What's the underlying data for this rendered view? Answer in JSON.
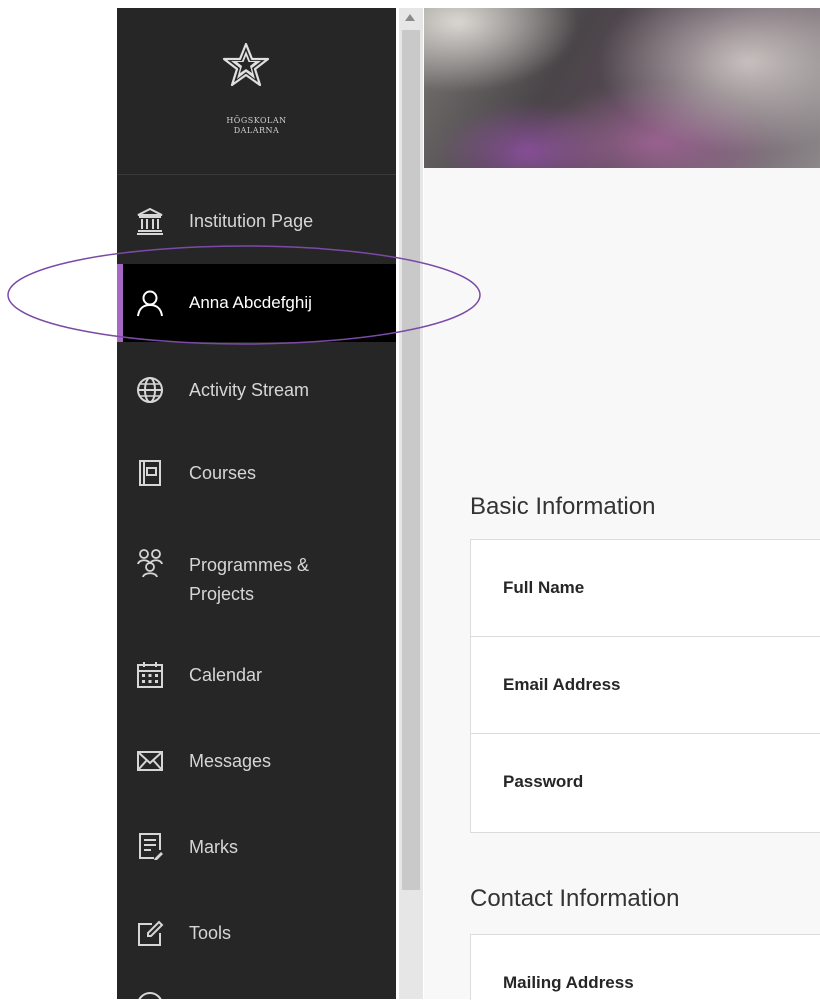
{
  "app": {
    "logo_text_line1": "HÖGSKOLAN",
    "logo_text_line2": "DALARNA"
  },
  "sidebar": {
    "items": [
      {
        "id": "institution",
        "label": "Institution Page",
        "icon": "institution-icon"
      },
      {
        "id": "profile",
        "label": "Anna Abcdefghij",
        "icon": "user-icon",
        "active": true
      },
      {
        "id": "activity",
        "label": "Activity Stream",
        "icon": "globe-icon"
      },
      {
        "id": "courses",
        "label": "Courses",
        "icon": "courses-icon"
      },
      {
        "id": "programmes",
        "label_line1": "Programmes &",
        "label_line2": "Projects",
        "icon": "people-icon"
      },
      {
        "id": "calendar",
        "label": "Calendar",
        "icon": "calendar-icon"
      },
      {
        "id": "messages",
        "label": "Messages",
        "icon": "envelope-icon"
      },
      {
        "id": "marks",
        "label": "Marks",
        "icon": "marks-icon"
      },
      {
        "id": "tools",
        "label": "Tools",
        "icon": "tools-icon"
      }
    ]
  },
  "main": {
    "basic_info": {
      "title": "Basic Information",
      "rows": [
        "Full Name",
        "Email Address",
        "Password"
      ]
    },
    "contact_info": {
      "title": "Contact Information",
      "rows": [
        "Mailing Address"
      ]
    }
  },
  "colors": {
    "sidebar_bg": "#262626",
    "active_bg": "#000000",
    "accent": "#a569c5",
    "annotation": "#7b4aa8"
  }
}
